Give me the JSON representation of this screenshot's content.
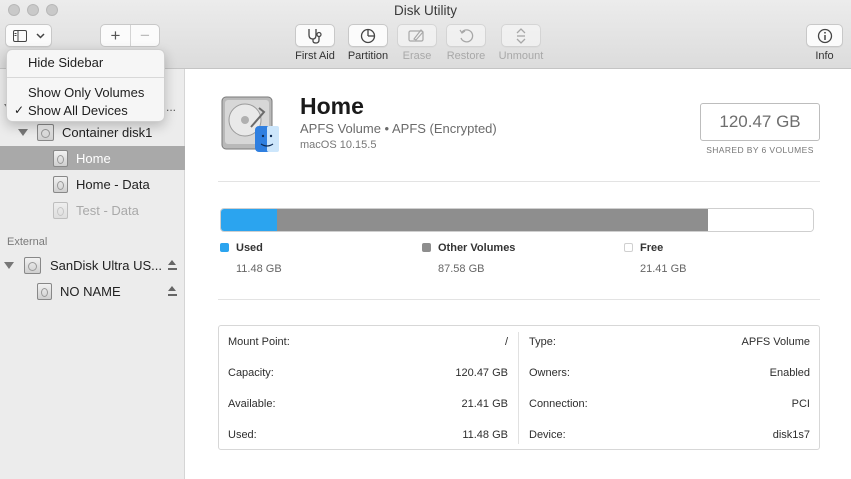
{
  "window": {
    "title": "Disk Utility"
  },
  "toolbar": {
    "first_aid": "First Aid",
    "partition": "Partition",
    "erase": "Erase",
    "restore": "Restore",
    "unmount": "Unmount",
    "info": "Info",
    "add_label": "+",
    "remove_label": "−"
  },
  "menu": {
    "hide_sidebar": "Hide Sidebar",
    "show_only_volumes": "Show Only Volumes",
    "show_all_devices": "Show All Devices",
    "checked_item": "Show All Devices",
    "checkmark": "✓"
  },
  "sidebar": {
    "more": "...",
    "container": "Container disk1",
    "volumes": [
      {
        "label": "Home",
        "selected": true
      },
      {
        "label": "Home - Data",
        "selected": false
      },
      {
        "label": "Test - Data",
        "selected": false,
        "dimmed": true
      }
    ],
    "external_header": "External",
    "external_disk": "SanDisk Ultra US...",
    "external_volume": "NO NAME"
  },
  "volume": {
    "name": "Home",
    "subtitle": "APFS Volume • APFS (Encrypted)",
    "os": "macOS 10.15.5",
    "capacity": "120.47 GB",
    "shared": "SHARED BY 6 VOLUMES"
  },
  "usage": {
    "segments": [
      {
        "label": "Used",
        "value": "11.48 GB",
        "gb": 11.48,
        "color": "#2ba4ef"
      },
      {
        "label": "Other Volumes",
        "value": "87.58 GB",
        "gb": 87.58,
        "color": "#8e8e8e"
      },
      {
        "label": "Free",
        "value": "21.41 GB",
        "gb": 21.41,
        "color": "#ffffff"
      }
    ]
  },
  "details": {
    "left": [
      {
        "label": "Mount Point:",
        "value": "/"
      },
      {
        "label": "Capacity:",
        "value": "120.47 GB"
      },
      {
        "label": "Available:",
        "value": "21.41 GB"
      },
      {
        "label": "Used:",
        "value": "11.48 GB"
      }
    ],
    "right": [
      {
        "label": "Type:",
        "value": "APFS Volume"
      },
      {
        "label": "Owners:",
        "value": "Enabled"
      },
      {
        "label": "Connection:",
        "value": "PCI"
      },
      {
        "label": "Device:",
        "value": "disk1s7"
      }
    ]
  }
}
